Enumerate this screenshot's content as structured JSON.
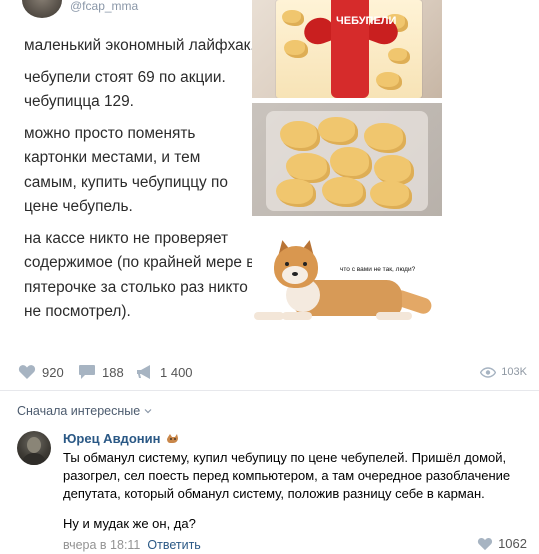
{
  "post": {
    "handle": "@fcap_mma",
    "paragraphs": [
      "маленький экономный лайфхак.",
      "чебупели стоят 69 по акции. чебупицца 129.",
      "можно просто поменять картонки местами, и тем самым, купить чебупиццу по цене чебупель.",
      "на кассе никто не проверяет содержимое (по крайней мере в пятерочке за столько раз никто не посмотрел)."
    ],
    "pack_label": "ЧЕБУПЕЛИ",
    "dog_caption": "что с вами не так, люди?"
  },
  "stats": {
    "likes": "920",
    "comments": "188",
    "reposts": "1 400",
    "views": "103K"
  },
  "comments_section": {
    "sort_label": "Сначала интересные"
  },
  "comment": {
    "author": "Юрец Авдонин",
    "text": "Ты обманул систему, купил чебупицу по цене чебупелей. Пришёл домой, разогрел, сел поесть перед компьютером, а там очередное разоблачение депутата, который обманул систему, положив разницу себе в карман.",
    "text2": "Ну и мудак же он, да?",
    "time": "вчера в 18:11",
    "reply_label": "Ответить",
    "likes": "1062"
  },
  "colors": {
    "link": "#2a5885",
    "muted": "#939393",
    "icon": "#a7b4c2"
  }
}
